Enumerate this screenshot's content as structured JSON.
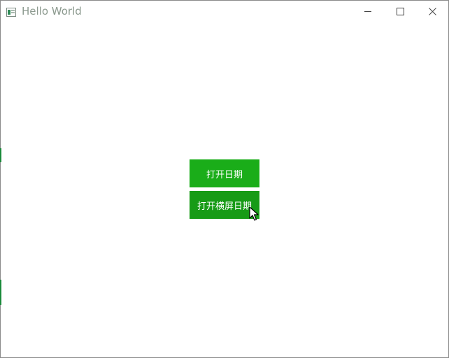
{
  "window": {
    "title": "Hello World",
    "icon": "app-window-icon",
    "controls": {
      "minimize": "minimize-icon",
      "maximize": "maximize-icon",
      "close": "close-icon"
    }
  },
  "main": {
    "open_date_label": "打开日期",
    "open_landscape_date_label": "打开横屏日期"
  },
  "colors": {
    "button_primary": "#1aad19",
    "button_hover": "#179b16",
    "title_text": "#8c9a8f"
  }
}
